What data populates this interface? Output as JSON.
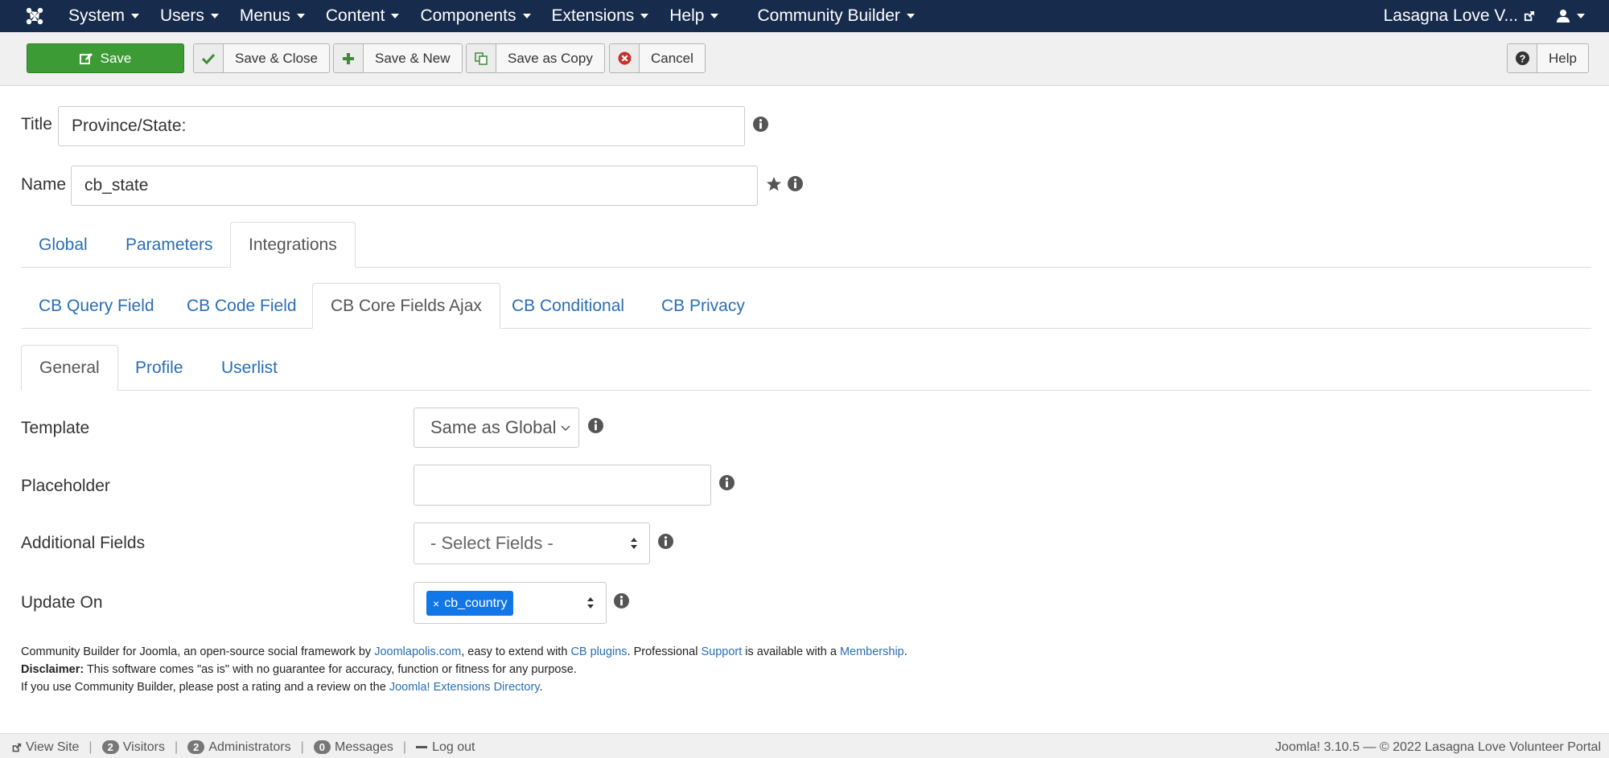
{
  "nav": {
    "menus": [
      "System",
      "Users",
      "Menus",
      "Content",
      "Components",
      "Extensions",
      "Help"
    ],
    "community_builder": "Community Builder",
    "site_name": "Lasagna Love V..."
  },
  "toolbar": {
    "save": "Save",
    "save_close": "Save & Close",
    "save_new": "Save & New",
    "save_copy": "Save as Copy",
    "cancel": "Cancel",
    "help": "Help"
  },
  "form": {
    "title_label": "Title",
    "title_value": "Province/State:",
    "name_label": "Name",
    "name_value": "cb_state"
  },
  "tabs_main": [
    "Global",
    "Parameters",
    "Integrations"
  ],
  "tabs_integrations": [
    "CB Query Field",
    "CB Code Field",
    "CB Core Fields Ajax",
    "CB Conditional",
    "CB Privacy"
  ],
  "tabs_sub": [
    "General",
    "Profile",
    "Userlist"
  ],
  "params": {
    "template_label": "Template",
    "template_value": "Same as Global",
    "placeholder_label": "Placeholder",
    "placeholder_value": "",
    "additional_label": "Additional Fields",
    "additional_value": "- Select Fields -",
    "update_label": "Update On",
    "update_chip": "cb_country"
  },
  "footer": {
    "line1_a": "Community Builder for Joomla, an open-source social framework by ",
    "link_joomlapolis": "Joomlapolis.com",
    "line1_b": ", easy to extend with ",
    "link_plugins": "CB plugins",
    "line1_c": ". Professional ",
    "link_support": "Support",
    "line1_d": " is available with a ",
    "link_membership": "Membership",
    "line1_e": ".",
    "disclaimer_label": "Disclaimer:",
    "disclaimer_text": " This software comes \"as is\" with no guarantee for accuracy, function or fitness for any purpose.",
    "line3_a": "If you use Community Builder, please post a rating and a review on the ",
    "link_jed": "Joomla! Extensions Directory",
    "line3_b": "."
  },
  "status": {
    "view_site": "View Site",
    "visitors_count": "2",
    "visitors": "Visitors",
    "admins_count": "2",
    "admins": "Administrators",
    "messages_count": "0",
    "messages": "Messages",
    "logout": "Log out",
    "copyright": "Joomla! 3.10.5  —  © 2022 Lasagna Love Volunteer Portal"
  }
}
